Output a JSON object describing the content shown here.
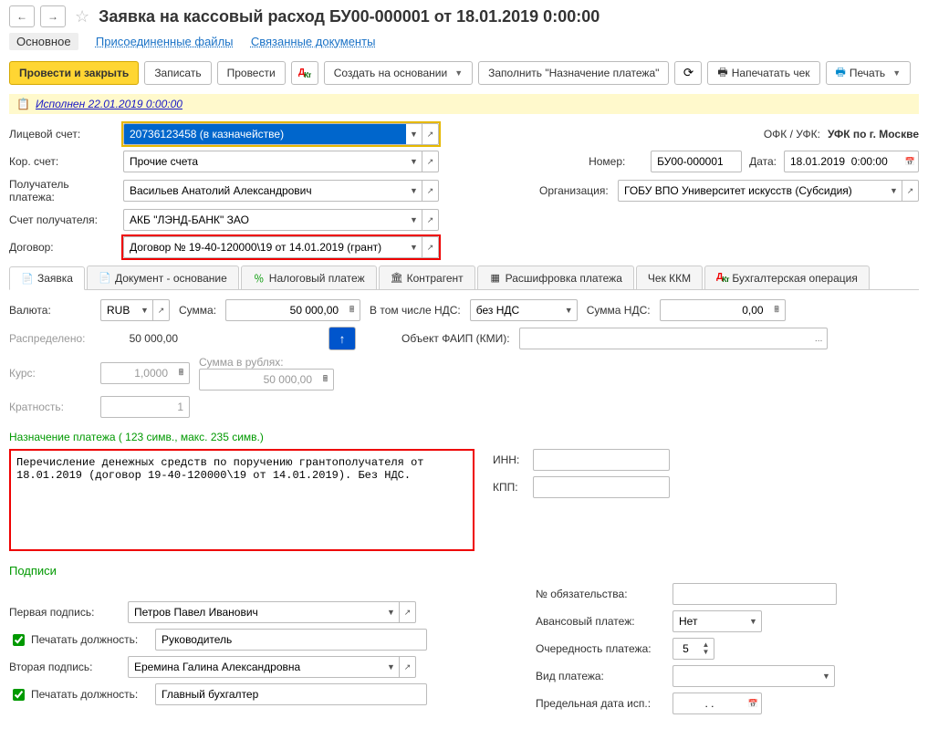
{
  "title": "Заявка на кассовый расход БУ00-000001 от 18.01.2019 0:00:00",
  "top_tabs": {
    "main": "Основное",
    "attached": "Присоединенные файлы",
    "linked": "Связанные документы"
  },
  "actions": {
    "post_close": "Провести и закрыть",
    "save": "Записать",
    "post": "Провести",
    "create_based": "Создать на основании",
    "fill_purpose": "Заполнить \"Назначение платежа\"",
    "print_cheque": "Напечатать чек",
    "print": "Печать"
  },
  "status": "Исполнен 22.01.2019 0:00:00",
  "fields": {
    "account_label": "Лицевой счет:",
    "account_value": "20736123458 (в казначействе)",
    "ofk_label": "ОФК / УФК:",
    "ofk_value": "УФК по г. Москве",
    "kor_label": "Кор. счет:",
    "kor_value": "Прочие счета",
    "number_label": "Номер:",
    "number_value": "БУ00-000001",
    "date_label": "Дата:",
    "date_value": "18.01.2019  0:00:00",
    "payee_label": "Получатель платежа:",
    "payee_value": "Васильев Анатолий Александрович",
    "org_label": "Организация:",
    "org_value": "ГОБУ ВПО Университет искусств (Субсидия)",
    "payee_acc_label": "Счет получателя:",
    "payee_acc_value": "АКБ \"ЛЭНД-БАНК\" ЗАО",
    "contract_label": "Договор:",
    "contract_value": "Договор № 19-40-120000\\19 от 14.01.2019 (грант)"
  },
  "tabs": {
    "t1": "Заявка",
    "t2": "Документ - основание",
    "t3": "Налоговый платеж",
    "t4": "Контрагент",
    "t5": "Расшифровка платежа",
    "t6": "Чек ККМ",
    "t7": "Бухгалтерская операция"
  },
  "request": {
    "currency_label": "Валюта:",
    "currency_value": "RUB",
    "sum_label": "Сумма:",
    "sum_value": "50 000,00",
    "vat_incl_label": "В том числе НДС:",
    "vat_incl_value": "без НДС",
    "vat_sum_label": "Сумма НДС:",
    "vat_sum_value": "0,00",
    "distributed_label": "Распределено:",
    "distributed_value": "50 000,00",
    "faip_label": "Объект ФАИП (КМИ):",
    "rate_label": "Курс:",
    "rate_value": "1,0000",
    "sum_rub_label": "Сумма в рублях:",
    "sum_rub_value": "50 000,00",
    "mult_label": "Кратность:",
    "mult_value": "1",
    "purpose_header": "Назначение платежа ( 123 симв., макс. 235 симв.)",
    "purpose_text": "Перечисление денежных средств по поручению грантополучателя от 18.01.2019 (договор 19-40-120000\\19 от 14.01.2019). Без НДС.",
    "inn_label": "ИНН:",
    "kpp_label": "КПП:"
  },
  "sign": {
    "header": "Подписи",
    "oblig_label": "№ обязательства:",
    "sign1_label": "Первая подпись:",
    "sign1_value": "Петров Павел Иванович",
    "advance_label": "Авансовый платеж:",
    "advance_value": "Нет",
    "print_pos": "Печатать должность:",
    "pos1_value": "Руководитель",
    "order_label": "Очередность платежа:",
    "order_value": "5",
    "sign2_label": "Вторая подпись:",
    "sign2_value": "Еремина Галина Александровна",
    "paytype_label": "Вид платежа:",
    "pos2_value": "Главный бухгалтер",
    "deadline_label": "Предельная дата исп.:",
    "dot": ". ."
  }
}
